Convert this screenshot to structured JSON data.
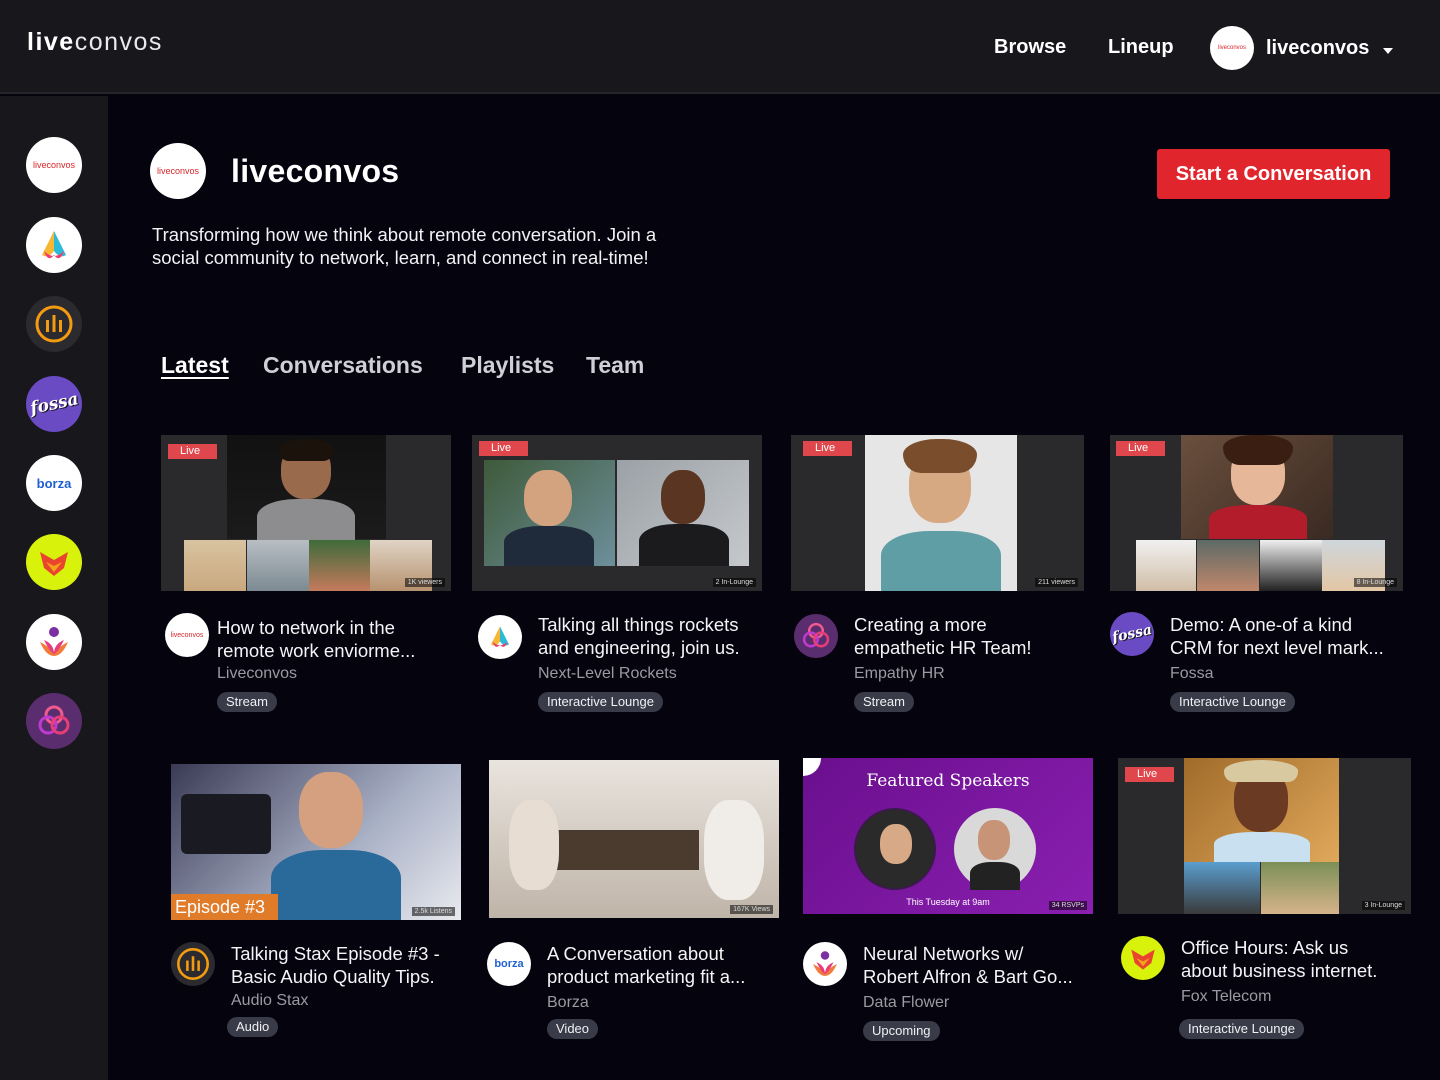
{
  "topbar": {
    "brand_bold": "live",
    "brand_light": "convos",
    "browse": "Browse",
    "lineup": "Lineup",
    "avatar_text": "liveconvos",
    "user": "liveconvos"
  },
  "sidebar": {
    "items": [
      {
        "name": "liveconvos",
        "label": "liveconvos"
      },
      {
        "name": "next-level-rockets"
      },
      {
        "name": "audio-stax"
      },
      {
        "name": "fossa",
        "label": "fossa"
      },
      {
        "name": "borza",
        "label": "borza"
      },
      {
        "name": "fox-telecom"
      },
      {
        "name": "data-flower"
      },
      {
        "name": "empathy-hr"
      }
    ]
  },
  "header": {
    "logo_text": "liveconvos",
    "org_name": "liveconvos",
    "cta": "Start a Conversation",
    "tagline": "Transforming how we think about remote conversation. Join a social community to network, learn, and connect in real-time!"
  },
  "tabs": [
    {
      "label": "Latest",
      "active": true
    },
    {
      "label": "Conversations"
    },
    {
      "label": "Playlists"
    },
    {
      "label": "Team"
    }
  ],
  "cards": [
    {
      "title_1": "How to network in the",
      "title_2": "remote work enviorme...",
      "org": "Liveconvos",
      "type": "Stream",
      "live": "Live",
      "count": "1K viewers",
      "avatar_text": "liveconvos"
    },
    {
      "title_1": "Talking all things rockets",
      "title_2": "and engineering, join us.",
      "org": "Next-Level Rockets",
      "type": "Interactive Lounge",
      "live": "Live",
      "count": "2 In-Lounge"
    },
    {
      "title_1": "Creating a more",
      "title_2": "empathetic HR Team!",
      "org": "Empathy HR",
      "type": "Stream",
      "live": "Live",
      "count": "211 viewers"
    },
    {
      "title_1": "Demo: A one-of a kind",
      "title_2": "CRM for next level mark...",
      "org": "Fossa",
      "type": "Interactive Lounge",
      "live": "Live",
      "count": "8 In-Lounge",
      "avatar_text": "fossa"
    },
    {
      "title_1": "Talking Stax Episode #3 -",
      "title_2": "Basic Audio Quality Tips.",
      "org": "Audio Stax",
      "type": "Audio",
      "badge": "Episode #3",
      "count": "2.5k Listens"
    },
    {
      "title_1": "A Conversation about",
      "title_2": "product marketing fit a...",
      "org": "Borza",
      "type": "Video",
      "count": "167K Views",
      "avatar_text": "borza"
    },
    {
      "title_1": "Neural Networks w/",
      "title_2": "Robert Alfron & Bart Go...",
      "org": "Data Flower",
      "type": "Upcoming",
      "featured": "Featured Speakers",
      "when": "This Tuesday at 9am",
      "count": "34 RSVPs"
    },
    {
      "title_1": "Office Hours: Ask us",
      "title_2": "about business internet.",
      "org": "Fox Telecom",
      "type": "Interactive Lounge",
      "live": "Live",
      "count": "3 In-Lounge"
    }
  ],
  "colors": {
    "accent": "#e0252c",
    "background": "#05040e",
    "panel": "#18171c",
    "pill": "#3a3b49"
  }
}
